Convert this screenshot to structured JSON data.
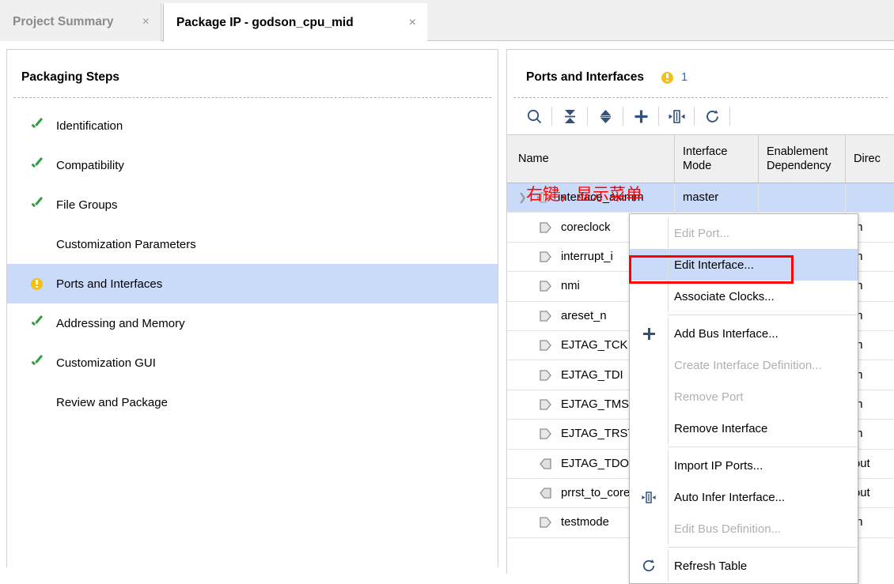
{
  "tabs": [
    {
      "label": "Project Summary",
      "close": "×",
      "active": false
    },
    {
      "label": "Package IP - godson_cpu_mid",
      "close": "×",
      "active": true
    }
  ],
  "left_panel": {
    "title": "Packaging Steps",
    "steps": [
      {
        "label": "Identification",
        "status": "check",
        "selected": false
      },
      {
        "label": "Compatibility",
        "status": "check",
        "selected": false
      },
      {
        "label": "File Groups",
        "status": "check",
        "selected": false
      },
      {
        "label": "Customization Parameters",
        "status": "none",
        "selected": false
      },
      {
        "label": "Ports and Interfaces",
        "status": "warning",
        "selected": true
      },
      {
        "label": "Addressing and Memory",
        "status": "check",
        "selected": false
      },
      {
        "label": "Customization GUI",
        "status": "check",
        "selected": false
      },
      {
        "label": "Review and Package",
        "status": "none",
        "selected": false
      }
    ]
  },
  "right_panel": {
    "title": "Ports and Interfaces",
    "warning_count": "1",
    "toolbar": [
      {
        "name": "search-icon",
        "tooltip": "Search"
      },
      {
        "name": "collapse-all-icon",
        "tooltip": "Collapse All"
      },
      {
        "name": "expand-all-icon",
        "tooltip": "Expand All"
      },
      {
        "name": "add-icon",
        "tooltip": "Add"
      },
      {
        "name": "bus-interface-icon",
        "tooltip": "Auto Infer Interface"
      },
      {
        "name": "refresh-icon",
        "tooltip": "Refresh Table"
      }
    ],
    "table": {
      "columns": [
        "Name",
        "Interface Mode",
        "Enablement Dependency",
        "Direc"
      ],
      "rows": [
        {
          "name": "interface_aximm",
          "mode": "master",
          "enable": "",
          "dir": "",
          "icon": "bus-interface",
          "expander": true,
          "indent": false,
          "selected": true
        },
        {
          "name": "coreclock",
          "mode": "",
          "enable": "",
          "dir": "in",
          "icon": "port-in",
          "expander": false,
          "indent": true,
          "selected": false
        },
        {
          "name": "interrupt_i",
          "mode": "",
          "enable": "",
          "dir": "in",
          "icon": "port-in",
          "expander": false,
          "indent": true,
          "selected": false
        },
        {
          "name": "nmi",
          "mode": "",
          "enable": "",
          "dir": "in",
          "icon": "port-in",
          "expander": false,
          "indent": true,
          "selected": false
        },
        {
          "name": "areset_n",
          "mode": "",
          "enable": "",
          "dir": "in",
          "icon": "port-in",
          "expander": false,
          "indent": true,
          "selected": false
        },
        {
          "name": "EJTAG_TCK",
          "mode": "",
          "enable": "",
          "dir": "in",
          "icon": "port-in",
          "expander": false,
          "indent": true,
          "selected": false
        },
        {
          "name": "EJTAG_TDI",
          "mode": "",
          "enable": "",
          "dir": "in",
          "icon": "port-in",
          "expander": false,
          "indent": true,
          "selected": false
        },
        {
          "name": "EJTAG_TMS",
          "mode": "",
          "enable": "",
          "dir": "in",
          "icon": "port-in",
          "expander": false,
          "indent": true,
          "selected": false
        },
        {
          "name": "EJTAG_TRST",
          "mode": "",
          "enable": "",
          "dir": "in",
          "icon": "port-in",
          "expander": false,
          "indent": true,
          "selected": false
        },
        {
          "name": "EJTAG_TDO",
          "mode": "",
          "enable": "",
          "dir": "out",
          "icon": "port-out",
          "expander": false,
          "indent": true,
          "selected": false
        },
        {
          "name": "prrst_to_core",
          "mode": "",
          "enable": "",
          "dir": "out",
          "icon": "port-out",
          "expander": false,
          "indent": true,
          "selected": false
        },
        {
          "name": "testmode",
          "mode": "",
          "enable": "",
          "dir": "in",
          "icon": "port-in",
          "expander": false,
          "indent": true,
          "selected": false
        }
      ]
    }
  },
  "annotation": {
    "text": "右键，显示菜单",
    "color": "#ff0000"
  },
  "context_menu": {
    "items": [
      {
        "label": "Edit Port...",
        "icon": "",
        "disabled": true,
        "highlight": false,
        "divider_after": false
      },
      {
        "label": "Edit Interface...",
        "icon": "",
        "disabled": false,
        "highlight": true,
        "divider_after": false
      },
      {
        "label": "Associate Clocks...",
        "icon": "",
        "disabled": false,
        "highlight": false,
        "divider_after": true
      },
      {
        "label": "Add Bus Interface...",
        "icon": "add-icon",
        "disabled": false,
        "highlight": false,
        "divider_after": false
      },
      {
        "label": "Create Interface Definition...",
        "icon": "",
        "disabled": true,
        "highlight": false,
        "divider_after": false
      },
      {
        "label": "Remove Port",
        "icon": "",
        "disabled": true,
        "highlight": false,
        "divider_after": false
      },
      {
        "label": "Remove Interface",
        "icon": "",
        "disabled": false,
        "highlight": false,
        "divider_after": true
      },
      {
        "label": "Import IP Ports...",
        "icon": "",
        "disabled": false,
        "highlight": false,
        "divider_after": false
      },
      {
        "label": "Auto Infer Interface...",
        "icon": "bus-interface-icon",
        "disabled": false,
        "highlight": false,
        "divider_after": false
      },
      {
        "label": "Edit Bus Definition...",
        "icon": "",
        "disabled": true,
        "highlight": false,
        "divider_after": true
      },
      {
        "label": "Refresh Table",
        "icon": "refresh-icon",
        "disabled": false,
        "highlight": false,
        "divider_after": false
      }
    ]
  },
  "colors": {
    "selection_blue": "#c9dbf8",
    "icon_blue": "#31527e",
    "check_green": "#2e9e3e",
    "warning_yellow": "#f2c019",
    "annotation_red": "#ff0000",
    "link_blue": "#2f6db5"
  }
}
